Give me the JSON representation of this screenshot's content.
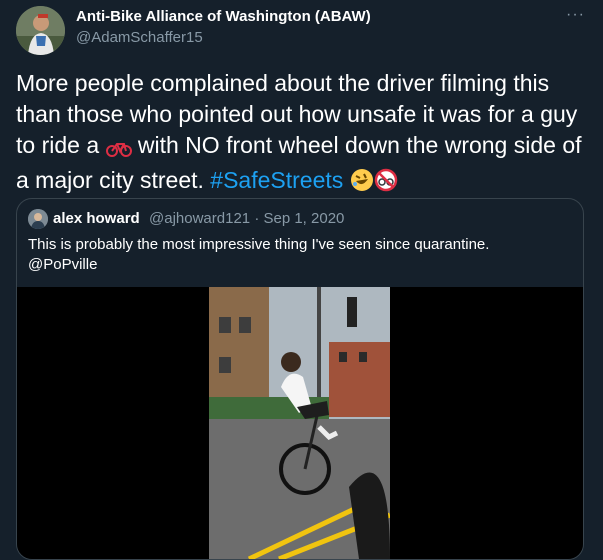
{
  "tweet": {
    "author_name": "Anti-Bike Alliance of Washington (ABAW)",
    "author_handle": "@AdamSchaffer15",
    "more_icon": "more-dots-icon",
    "text_part1": "More people complained about the driver filming this than those who pointed out how unsafe it was for a guy to ride a ",
    "text_part2": " with NO front wheel down the wrong side of a major city street. ",
    "hashtag": "#SafeStreets",
    "emojis": [
      "bicycle-emoji",
      "rofl-emoji",
      "no-bicycles-emoji"
    ]
  },
  "quote": {
    "author_name": "alex howard",
    "author_handle": "@ajhoward121",
    "separator": "·",
    "date": "Sep 1, 2020",
    "text_line1": "This is probably the most impressive thing I've seen since quarantine.",
    "text_line2": "@PoPville",
    "media": "video-thumbnail"
  },
  "colors": {
    "background": "#15202b",
    "secondary_text": "#8899a6",
    "link": "#1da1f2",
    "border": "#38444d"
  }
}
